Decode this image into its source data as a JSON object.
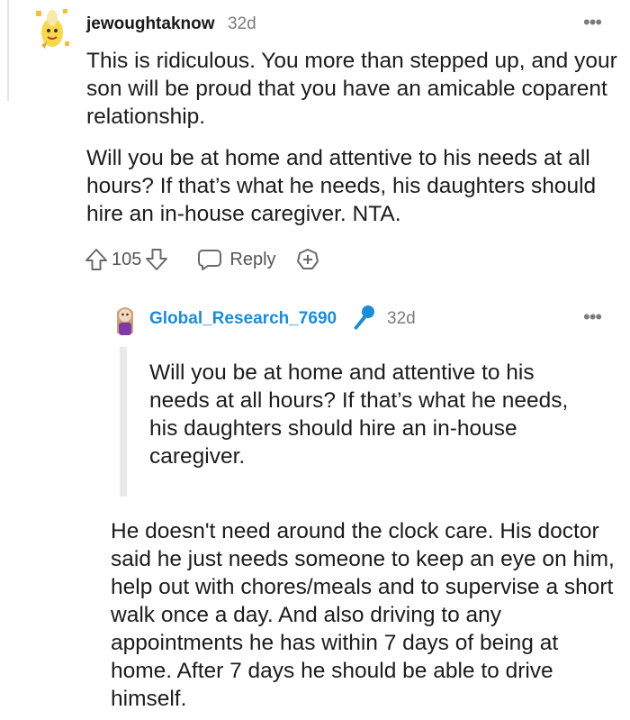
{
  "comment": {
    "username": "jewoughtaknow",
    "age": "32d",
    "paragraphs": [
      "This is ridiculous. You more than stepped up, and your son will be proud that you have an amicable coparent relationship.",
      "Will you be at home and attentive to his needs at all hours? If that’s what he needs, his daughters should hire an in-house caregiver. NTA."
    ],
    "score": "105",
    "reply_label": "Reply",
    "more_icon": "more-options-icon",
    "upvote_icon": "upvote-arrow-icon",
    "downvote_icon": "downvote-arrow-icon",
    "reply_icon": "speech-bubble-icon",
    "award_icon": "add-award-icon"
  },
  "reply": {
    "username": "Global_Research_7690",
    "flair_icon": "microphone-icon",
    "age": "32d",
    "quote": "Will you be at home and attentive to his needs at all hours? If that’s what he needs, his daughters should hire an in-house caregiver.",
    "paragraph": "He doesn't need around the clock care. His doctor said he just needs someone to keep an eye on him, help out with chores/meals and to supervise a short walk once a day. And also driving to any appointments he has within 7 days of being at home. After 7 days he should be able to drive himself."
  },
  "colors": {
    "username_link": "#1a8cd8",
    "meta_gray": "#7c7c7c",
    "quote_bar": "#e9e9e9",
    "mic_blue": "#1a8cd8"
  }
}
